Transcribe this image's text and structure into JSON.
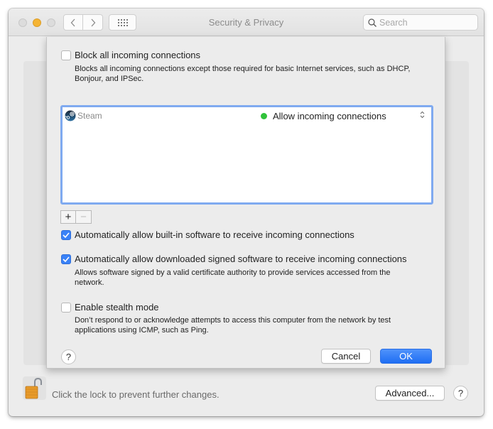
{
  "window": {
    "title": "Security & Privacy",
    "search": {
      "placeholder": "Search",
      "value": ""
    },
    "nav": {
      "back_glyph": "‹",
      "forward_glyph": "›"
    }
  },
  "sheet": {
    "block_all": {
      "label": "Block all incoming connections",
      "checked": false,
      "description": "Blocks all incoming connections except those required for basic Internet services, such as DHCP, Bonjour, and IPSec."
    },
    "app_list": [
      {
        "name": "Steam",
        "icon": "steam-icon",
        "status": "Allow incoming connections",
        "status_color": "#30c23a"
      }
    ],
    "add_button": "+",
    "remove_button": "−",
    "auto_builtin": {
      "label": "Automatically allow built-in software to receive incoming connections",
      "checked": true
    },
    "auto_signed": {
      "label": "Automatically allow downloaded signed software to receive incoming connections",
      "checked": true,
      "description": "Allows software signed by a valid certificate authority to provide services accessed from the network."
    },
    "stealth": {
      "label": "Enable stealth mode",
      "checked": false,
      "description": "Don’t respond to or acknowledge attempts to access this computer from the network by test applications using ICMP, such as Ping."
    },
    "help_label": "?",
    "cancel_label": "Cancel",
    "ok_label": "OK"
  },
  "footer": {
    "lock_text": "Click the lock to prevent further changes.",
    "advanced_label": "Advanced...",
    "help_label": "?"
  },
  "colors": {
    "accent": "#1f6ef3",
    "focus_ring": "#7faaf0",
    "status_green": "#30c23a"
  }
}
